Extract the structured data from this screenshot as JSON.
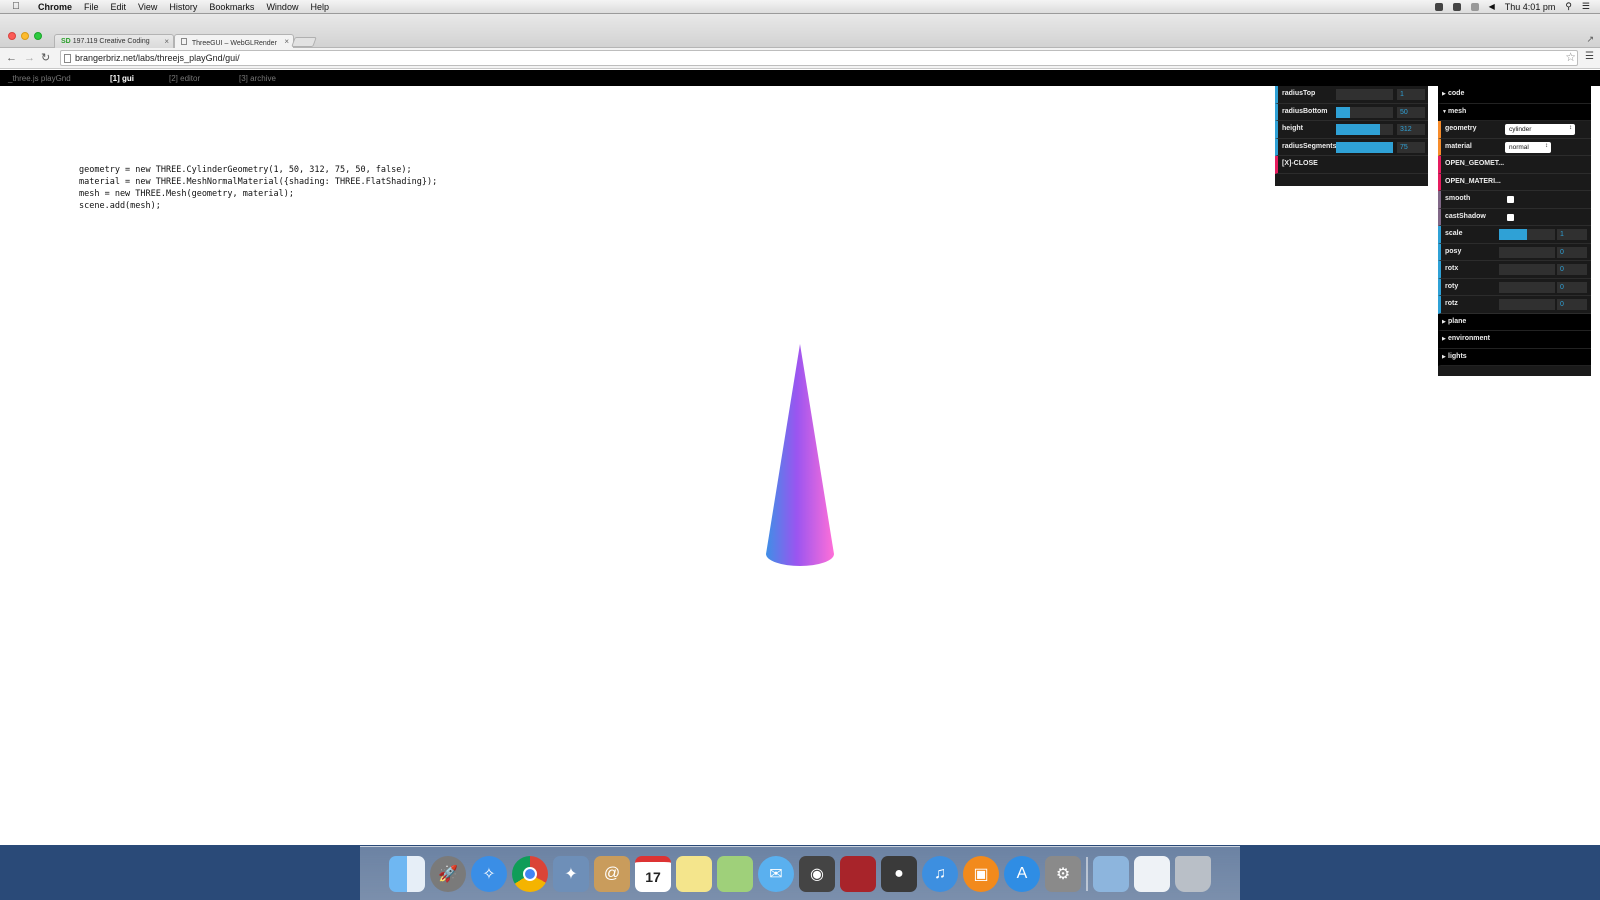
{
  "menubar": {
    "app": "Chrome",
    "items": [
      "File",
      "Edit",
      "View",
      "History",
      "Bookmarks",
      "Window",
      "Help"
    ],
    "clock": "Thu 4:01 pm"
  },
  "browser": {
    "tabs": [
      {
        "label": "197.119 Creative Coding",
        "favicon": "SD",
        "active": false
      },
      {
        "label": "ThreeGUI – WebGLRender",
        "active": true
      }
    ],
    "url": "brangerbriz.net/labs/threejs_playGnd/gui/"
  },
  "page": {
    "nav": [
      {
        "label": "_three.js playGnd",
        "current": false
      },
      {
        "label": "[1] gui",
        "current": true
      },
      {
        "label": "[2] editor",
        "current": false
      },
      {
        "label": "[3] archive",
        "current": false
      }
    ],
    "code": [
      "geometry = new THREE.CylinderGeometry(1, 50, 312, 75, 50, false);",
      "material = new THREE.MeshNormalMaterial({shading: THREE.FlatShading});",
      "mesh = new THREE.Mesh(geometry, material);",
      "scene.add(mesh);"
    ]
  },
  "geometry_panel": {
    "controls": [
      {
        "label": "radiusTop",
        "value": "1",
        "fraction": 0.0
      },
      {
        "label": "radiusBottom",
        "value": "50",
        "fraction": 0.25
      },
      {
        "label": "height",
        "value": "312",
        "fraction": 0.78
      },
      {
        "label": "radiusSegments",
        "value": "75",
        "fraction": 1.0
      }
    ],
    "close_label": "[X]-CLOSE"
  },
  "main_panel": {
    "code_folder": "code",
    "mesh_folder": "mesh",
    "geometry_label": "geometry",
    "geometry_value": "cylinder",
    "material_label": "material",
    "material_value": "normal",
    "open_geometry": "OPEN_GEOMET...",
    "open_material": "OPEN_MATERI...",
    "smooth_label": "smooth",
    "castshadow_label": "castShadow",
    "numeric": [
      {
        "label": "scale",
        "value": "1",
        "fraction": 0.5
      },
      {
        "label": "posy",
        "value": "0",
        "fraction": 0.0
      },
      {
        "label": "rotx",
        "value": "0",
        "fraction": 0.0
      },
      {
        "label": "roty",
        "value": "0",
        "fraction": 0.0
      },
      {
        "label": "rotz",
        "value": "0",
        "fraction": 0.0
      }
    ],
    "plane_folder": "plane",
    "environment_folder": "environment",
    "lights_folder": "lights"
  },
  "colors": {
    "gui_accent": "#2fa1d6",
    "gui_button": "#e61d5f",
    "cone_left": "#3f8fe6",
    "cone_mid": "#9a55f0",
    "cone_right": "#ff6fd8"
  },
  "dock": {
    "icons": [
      "finder-icon",
      "launchpad-icon",
      "safari-icon",
      "chrome-icon",
      "preview-icon",
      "contacts-icon",
      "calendar-icon",
      "notes-icon",
      "maps-icon",
      "messages-icon",
      "facetime-icon",
      "photobooth-icon",
      "iphoto-icon",
      "itunes-icon",
      "ibooks-icon",
      "appstore-icon",
      "system-preferences-icon",
      "downloads-folder-icon",
      "documents-icon",
      "trash-icon"
    ],
    "calendar_day": "17"
  }
}
